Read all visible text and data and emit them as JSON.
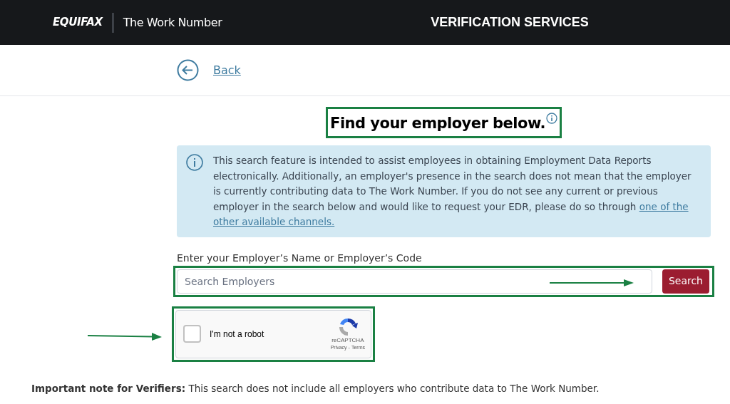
{
  "header": {
    "brand": "EQUIFAX",
    "product": "The Work Number",
    "title": "VERIFICATION SERVICES"
  },
  "back_link": "Back",
  "heading": "Find your employer below.",
  "info_text": "This search feature is intended to assist employees in obtaining Employment Data Reports electronically. Additionally, an employer's presence in the search does not mean that the employer is currently contributing data to The Work Number. If you do not see any current or previous employer in the search below and would like to request your EDR, please do so through",
  "info_link_lines": [
    "one of the",
    "other available channels."
  ],
  "search": {
    "label": "Enter your Employer’s Name or Employer’s Code",
    "placeholder": "Search Employers",
    "button": "Search"
  },
  "captcha": {
    "label": "I'm not a robot",
    "checked": false,
    "brand": "reCAPTCHA",
    "privacy": "Privacy",
    "separator": "-",
    "terms": "Terms"
  },
  "note": "**Important note for Verifiers:** This search does not include all employers who contribute data to The Work Number."
}
